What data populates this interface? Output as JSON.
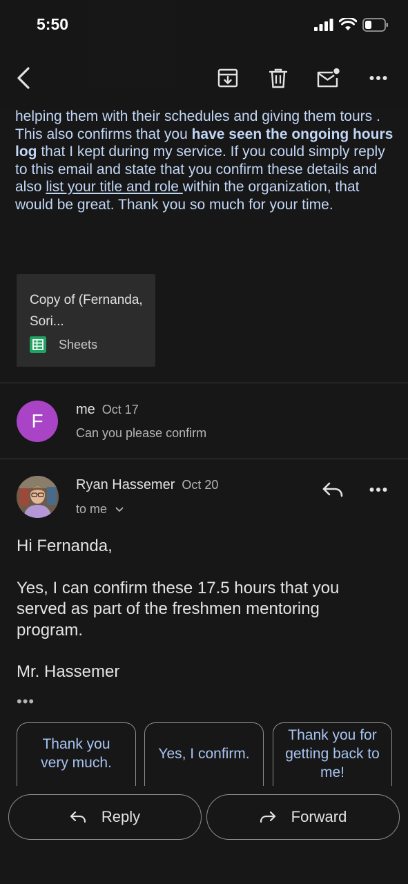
{
  "status_bar": {
    "time": "5:50"
  },
  "email": {
    "body_lines": {
      "p1": "helping them with their schedules and giving them tours . This also confirms that you ",
      "bold1": "have seen the ongoing hours log",
      "p2": " that I kept during my service. If you could simply reply to this email and state that you confirm these details and also ",
      "underline1": "list your title and role ",
      "p3": "within the organization, that would be great.  Thank you so much for your time."
    },
    "attachment": {
      "name": "Copy of (Fernanda, Sori...",
      "type": "Sheets"
    }
  },
  "messages": [
    {
      "avatar_letter": "F",
      "sender": "me",
      "date": "Oct 17",
      "snippet": "Can you please confirm"
    },
    {
      "sender": "Ryan Hassemer",
      "date": "Oct 20",
      "recipient": "to me",
      "body": {
        "greeting": "Hi Fernanda,",
        "paragraph": "Yes, I can confirm these 17.5 hours that you served as part of the freshmen mentoring program.",
        "signature": "Mr. Hassemer"
      },
      "quoted_indicator": "•••"
    }
  ],
  "smart_replies": [
    "Thank you very much.",
    "Yes, I confirm.",
    "Thank you for getting back to me!"
  ],
  "actions": {
    "reply_label": "Reply",
    "forward_label": "Forward"
  }
}
